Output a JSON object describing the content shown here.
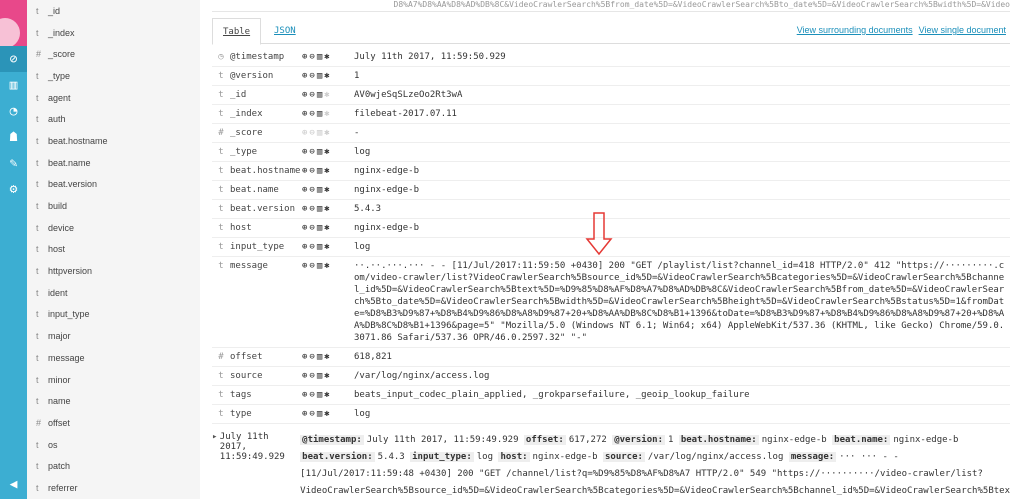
{
  "nav": {
    "icons": [
      "discover-icon",
      "visualize-icon",
      "dashboard-icon",
      "timelion-icon",
      "dev-tools-icon",
      "management-icon"
    ],
    "collapse_icon": "collapse-icon"
  },
  "fields": [
    [
      "t",
      "_id"
    ],
    [
      "t",
      "_index"
    ],
    [
      "#",
      "_score"
    ],
    [
      "t",
      "_type"
    ],
    [
      "t",
      "agent"
    ],
    [
      "t",
      "auth"
    ],
    [
      "t",
      "beat.hostname"
    ],
    [
      "t",
      "beat.name"
    ],
    [
      "t",
      "beat.version"
    ],
    [
      "t",
      "build"
    ],
    [
      "t",
      "device"
    ],
    [
      "t",
      "host"
    ],
    [
      "t",
      "httpversion"
    ],
    [
      "t",
      "ident"
    ],
    [
      "t",
      "input_type"
    ],
    [
      "t",
      "major"
    ],
    [
      "t",
      "message"
    ],
    [
      "t",
      "minor"
    ],
    [
      "t",
      "name"
    ],
    [
      "#",
      "offset"
    ],
    [
      "t",
      "os"
    ],
    [
      "t",
      "patch"
    ],
    [
      "t",
      "referrer"
    ]
  ],
  "top_snippet": "D8%A7%D8%AA%D8%AD%DB%8C&VideoCrawlerSearch%5Bfrom_date%5D=&VideoCrawlerSearch%5Bto_date%5D=&VideoCrawlerSearch%5Bwidth%5D=&Video",
  "tabs": {
    "table": "Table",
    "json": "JSON"
  },
  "links": {
    "surrounding": "View surrounding documents",
    "single": "View single document"
  },
  "doc": [
    [
      "◷",
      "@timestamp",
      "July 11th 2017, 11:59:50.929"
    ],
    [
      "t",
      "@version",
      "1"
    ],
    [
      "t",
      "_id",
      "AV0wjeSqSLzeOo2Rt3wA"
    ],
    [
      "t",
      "_index",
      "filebeat-2017.07.11"
    ],
    [
      "#",
      "_score",
      "-"
    ],
    [
      "t",
      "_type",
      "log"
    ],
    [
      "t",
      "beat.hostname",
      "nginx-edge-b"
    ],
    [
      "t",
      "beat.name",
      "nginx-edge-b"
    ],
    [
      "t",
      "beat.version",
      "5.4.3"
    ],
    [
      "t",
      "host",
      "nginx-edge-b"
    ],
    [
      "t",
      "input_type",
      "log"
    ],
    [
      "t",
      "message",
      "··.··.···.··· - - [11/Jul/2017:11:59:50 +0430] 200 \"GET /playlist/list?channel_id=418 HTTP/2.0\" 412 \"https://·········.com/video-crawler/list?VideoCrawlerSearch%5Bsource_id%5D=&VideoCrawlerSearch%5Bcategories%5D=&VideoCrawlerSearch%5Bchannel_id%5D=&VideoCrawlerSearch%5Btext%5D=%D9%85%D8%AF%D8%A7%D8%AD%DB%8C&VideoCrawlerSearch%5Bfrom_date%5D=&VideoCrawlerSearch%5Bto_date%5D=&VideoCrawlerSearch%5Bwidth%5D=&VideoCrawlerSearch%5Bheight%5D=&VideoCrawlerSearch%5Bstatus%5D=1&fromDate=%D8%B3%D9%87+%D8%B4%D9%86%D8%A8%D9%87+20+%D8%AA%DB%8C%D8%B1+1396&toDate=%D8%B3%D9%87+%D8%B4%D9%86%D8%A8%D9%87+20+%D8%AA%DB%8C%D8%B1+1396&page=5\" \"Mozilla/5.0 (Windows NT 6.1; Win64; x64) AppleWebKit/537.36 (KHTML, like Gecko) Chrome/59.0.3071.86 Safari/537.36 OPR/46.0.2597.32\" \"-\""
    ],
    [
      "#",
      "offset",
      "618,821"
    ],
    [
      "t",
      "source",
      "/var/log/nginx/access.log"
    ],
    [
      "t",
      "tags",
      "beats_input_codec_plain_applied, _grokparsefailure, _geoip_lookup_failure"
    ],
    [
      "t",
      "type",
      "log"
    ]
  ],
  "next": {
    "time": "July 11th 2017, 11:59:49.929",
    "pairs": [
      [
        "@timestamp:",
        "July 11th 2017, 11:59:49.929"
      ],
      [
        "offset:",
        "617,272"
      ],
      [
        "@version:",
        "1"
      ],
      [
        "beat.hostname:",
        "nginx-edge-b"
      ],
      [
        "beat.name:",
        "nginx-edge-b"
      ],
      [
        "beat.version:",
        "5.4.3"
      ],
      [
        "input_type:",
        "log"
      ],
      [
        "host:",
        "nginx-edge-b"
      ],
      [
        "source:",
        "/var/log/nginx/access.log"
      ],
      [
        "message:",
        "··· ··· - - [11/Jul/2017:11:59:48 +0430] 200 \"GET /channel/list?q=%D9%85%D8%AF%D8%A7 HTTP/2.0\" 549 \"https://··········/video-crawler/list?VideoCrawlerSearch%5Bsource_id%5D=&VideoCrawlerSearch%5Bcategories%5D=&VideoCrawlerSearch%5Bchannel_id%5D=&VideoCrawlerSearch%5Btex"
      ]
    ]
  },
  "colors": {
    "nav": "#3caed2",
    "logo": "#e8488a",
    "link": "#1a8fba",
    "arrow": "#e53935"
  }
}
